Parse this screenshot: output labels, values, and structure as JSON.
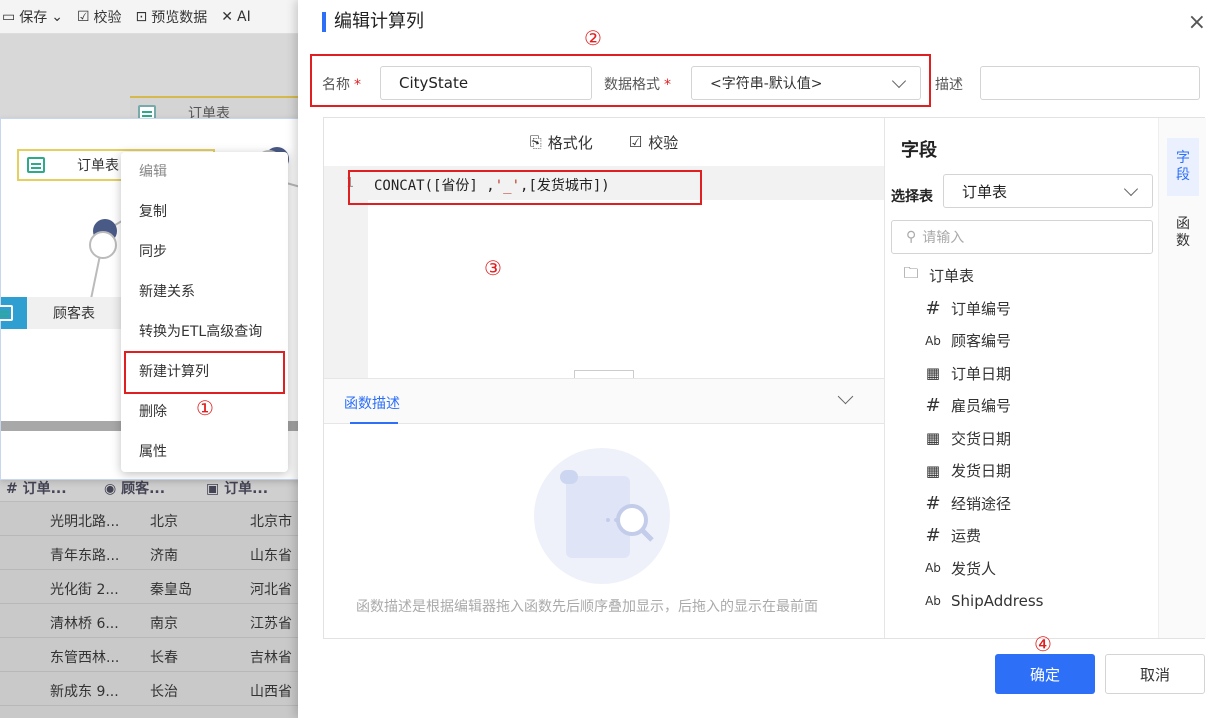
{
  "background": {
    "toolbar": {
      "save": "保存",
      "validate": "校验",
      "preview": "预览数据",
      "ai": "AI"
    },
    "nodes": {
      "orders_top": "订单表",
      "orders": "订单表",
      "customers": "顾客表"
    },
    "grid_headers": [
      "订单...",
      "顾客...",
      "订单..."
    ],
    "grid_rows": [
      [
        "光明北路...",
        "北京",
        "北京市"
      ],
      [
        "青年东路...",
        "济南",
        "山东省"
      ],
      [
        "光化街 2...",
        "秦皇岛",
        "河北省"
      ],
      [
        "清林桥 6...",
        "南京",
        "江苏省"
      ],
      [
        "东管西林...",
        "长春",
        "吉林省"
      ],
      [
        "新成东 9...",
        "长治",
        "山西省"
      ]
    ],
    "context_menu": [
      "编辑",
      "复制",
      "同步",
      "新建关系",
      "转换为ETL高级查询",
      "新建计算列",
      "删除",
      "属性"
    ]
  },
  "annotations": {
    "n1": "①",
    "n2": "②",
    "n3": "③",
    "n4": "④"
  },
  "dialog": {
    "title": "编辑计算列",
    "close": "×",
    "name_label": "名称",
    "name_value": "CityState",
    "format_label": "数据格式",
    "format_value": "<字符串-默认值>",
    "desc_label": "描述",
    "desc_value": "",
    "required_mark": "*",
    "editor": {
      "format_btn": "格式化",
      "validate_btn": "校验",
      "line_no": "1",
      "code_a": "CONCAT([省份] ,",
      "code_str": "'_'",
      "code_b": ",[发货城市])"
    },
    "func_desc": {
      "tab": "函数描述",
      "empty_text": "函数描述是根据编辑器拖入函数先后顺序叠加显示，后拖入的显示在最前面"
    },
    "fields_panel": {
      "title": "字段",
      "select_label": "选择表",
      "select_value": "订单表",
      "search_placeholder": "请输入",
      "folder": "订单表",
      "fields": [
        {
          "icon": "#",
          "name": "订单编号"
        },
        {
          "icon": "Ab",
          "name": "顾客编号"
        },
        {
          "icon": "date",
          "name": "订单日期"
        },
        {
          "icon": "#",
          "name": "雇员编号"
        },
        {
          "icon": "date",
          "name": "交货日期"
        },
        {
          "icon": "date",
          "name": "发货日期"
        },
        {
          "icon": "#",
          "name": "经销途径"
        },
        {
          "icon": "#",
          "name": "运费"
        },
        {
          "icon": "Ab",
          "name": "发货人"
        },
        {
          "icon": "Ab",
          "name": "ShipAddress"
        }
      ]
    },
    "side_tabs": {
      "fields": "字\n段",
      "functions": "函\n数"
    },
    "ok": "确定",
    "cancel": "取消",
    "colors": {
      "primary": "#2d6ff7",
      "annotation": "#e02020"
    }
  }
}
